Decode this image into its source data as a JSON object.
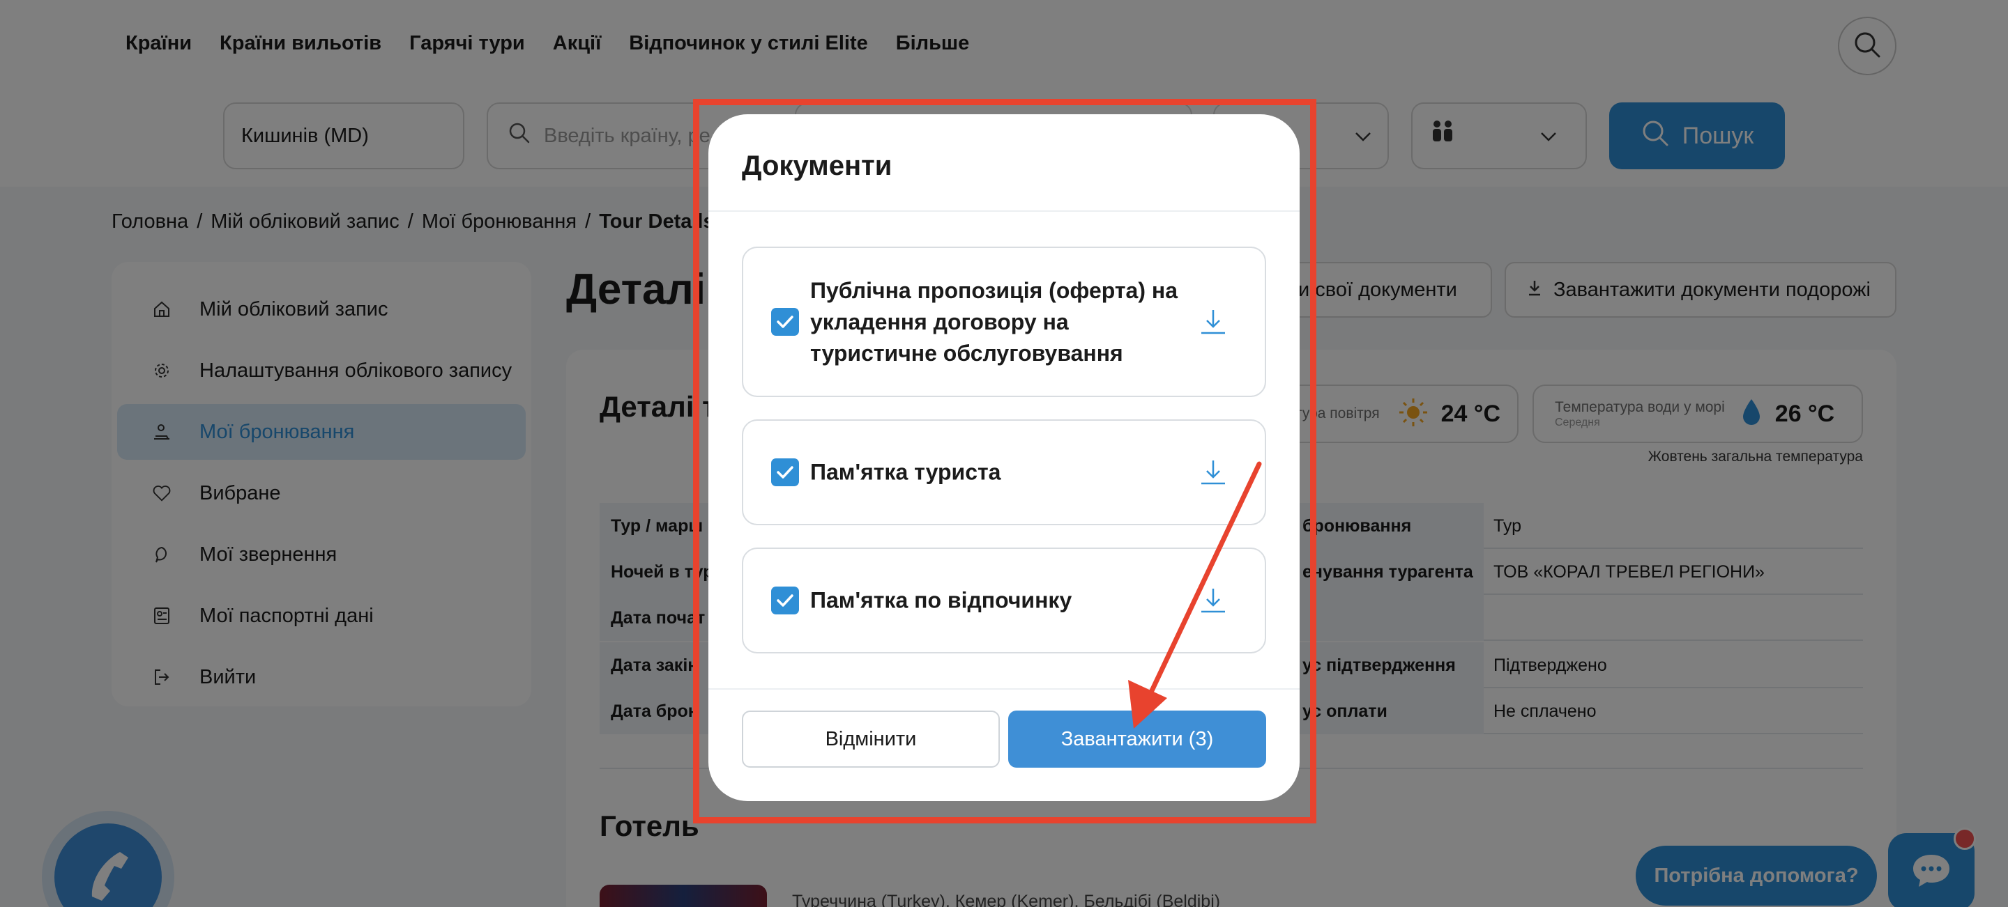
{
  "nav": {
    "items": [
      "Країни",
      "Країни вильотів",
      "Гарячі тури",
      "Акції",
      "Відпочинок у стилі Elite",
      "Більше"
    ]
  },
  "search": {
    "departure": "Кишинів (MD)",
    "destination_placeholder": "Введіть країну, ре",
    "button_label": "Пошук"
  },
  "breadcrumb": {
    "items": [
      "Головна",
      "Мій обліковий запис",
      "Мої бронювання",
      "Tour Details"
    ],
    "separator": "/"
  },
  "sidebar": {
    "items": [
      {
        "label": "Мій обліковий запис",
        "icon": "home-icon"
      },
      {
        "label": "Налаштування облікового запису",
        "icon": "gear-icon"
      },
      {
        "label": "Мої бронювання",
        "icon": "booking-icon"
      },
      {
        "label": "Вибране",
        "icon": "heart-icon"
      },
      {
        "label": "Мої звернення",
        "icon": "chat-bubble-icon"
      },
      {
        "label": "Мої паспортні дані",
        "icon": "passport-icon"
      },
      {
        "label": "Вийти",
        "icon": "logout-icon"
      }
    ],
    "active_index": 2
  },
  "main": {
    "title_visible": "Деталі",
    "own_docs_label_visible": "и свої документи",
    "trip_docs_label": "Завантажити документи подорожі",
    "details_title_visible": "Деталі т",
    "weather": {
      "air_label_visible": "тура повітря",
      "air_temp": "24 °C",
      "water_label": "Температура води у морі",
      "water_sub": "Середня",
      "water_temp": "26 °C",
      "note": "Жовтень загальна температура"
    },
    "table": [
      {
        "left": "Тур / марш",
        "right_label": "бронювання",
        "right_value": "Тур"
      },
      {
        "left": "Ночей в тур",
        "right_label": "енування турагента",
        "right_value": "ТОВ «КОРАЛ ТРЕВЕЛ РЕГІОНИ»"
      },
      {
        "left": "Дата почат",
        "right_label": "",
        "right_value": ""
      },
      {
        "left": "Дата закін",
        "right_label": "ус підтвердження",
        "right_value": "Підтверджено"
      },
      {
        "left": "Дата брон",
        "right_label": "ус оплати",
        "right_value": "Не сплачено"
      }
    ],
    "hotel_title": "Готель",
    "hotel_location_visible": "Туреччина (Turkey), Кемер (Kemer), Бельдібі (Beldibi)"
  },
  "help": {
    "bubble_label": "Потрібна допомога?"
  },
  "modal": {
    "title": "Документи",
    "documents": [
      {
        "label": "Публічна пропозиція (оферта) на укладення договору на туристичне обслуговування",
        "checked": true
      },
      {
        "label": "Пам'ятка туриста",
        "checked": true
      },
      {
        "label": "Пам'ятка по відпочинку",
        "checked": true
      }
    ],
    "cancel_label": "Відмінити",
    "download_label": "Завантажити (3)"
  },
  "colors": {
    "accent": "#2f8fd6",
    "highlight": "#e8432e",
    "overlay": "rgba(0,0,0,0.5)"
  }
}
